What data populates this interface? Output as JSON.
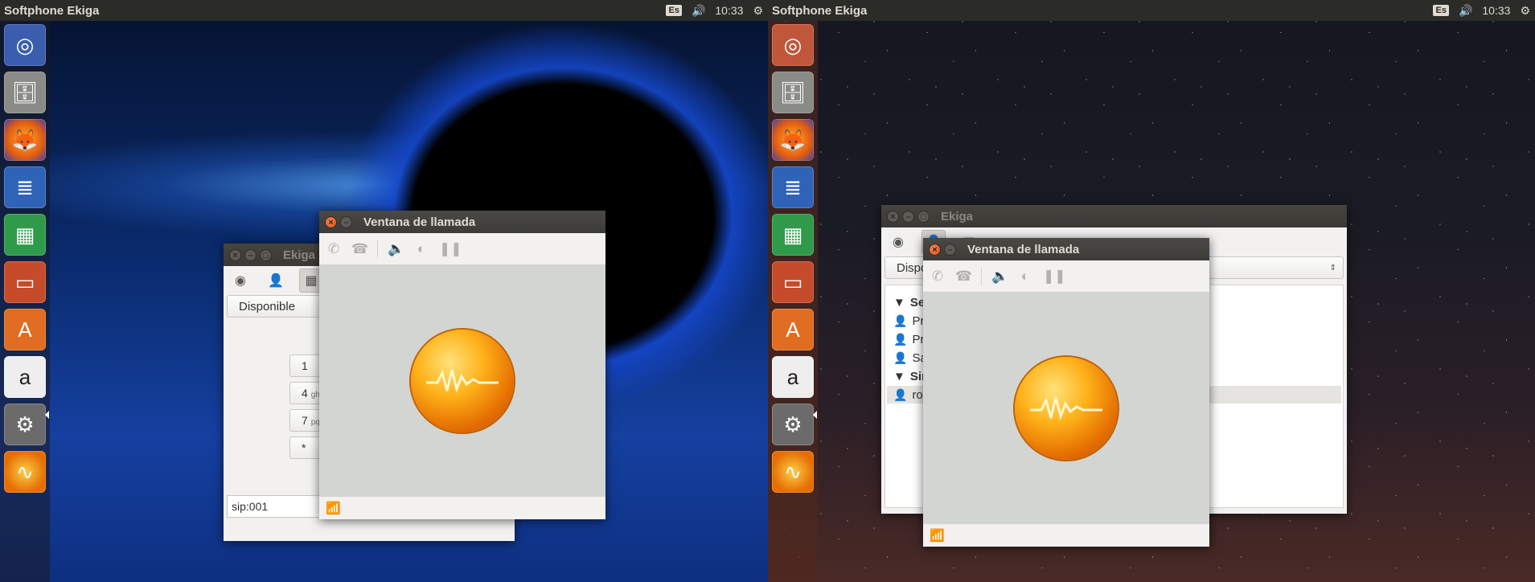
{
  "left": {
    "topbar": {
      "title": "Softphone Ekiga",
      "keyboard": "Es",
      "time": "10:33"
    },
    "launcher": [
      "ubuntu-dash",
      "files",
      "firefox",
      "writer",
      "calc",
      "impress",
      "software-center",
      "amazon",
      "system-settings",
      "ekiga"
    ],
    "ekiga_main": {
      "title": "Ekiga",
      "presence": "Disponible",
      "dialpad": [
        {
          "key": "1",
          "letters": ""
        },
        {
          "key": "4",
          "letters": "gh"
        },
        {
          "key": "7",
          "letters": "pq"
        },
        {
          "key": "*",
          "letters": ""
        }
      ],
      "uri": "sip:001"
    },
    "call_window": {
      "title": "Ventana de llamada"
    }
  },
  "right": {
    "topbar": {
      "title": "Softphone Ekiga",
      "keyboard": "Es",
      "time": "10:33"
    },
    "launcher": [
      "ubuntu-dash",
      "files",
      "firefox",
      "writer",
      "calc",
      "impress",
      "software-center",
      "amazon",
      "system-settings",
      "ekiga"
    ],
    "ekiga_main": {
      "title": "Ekiga",
      "presence": "Dispo",
      "roster": [
        {
          "type": "group",
          "label": "Serv"
        },
        {
          "type": "contact",
          "label": "Pru"
        },
        {
          "type": "contact",
          "label": "Pru"
        },
        {
          "type": "contact",
          "label": "Sa"
        },
        {
          "type": "group",
          "label": "Sin c"
        },
        {
          "type": "contact",
          "label": "rol",
          "selected": true
        }
      ]
    },
    "call_window": {
      "title": "Ventana de llamada"
    }
  },
  "colors": {
    "topbar": "#2b2b28",
    "accent": "#e56e00",
    "close": "#df4a16"
  }
}
